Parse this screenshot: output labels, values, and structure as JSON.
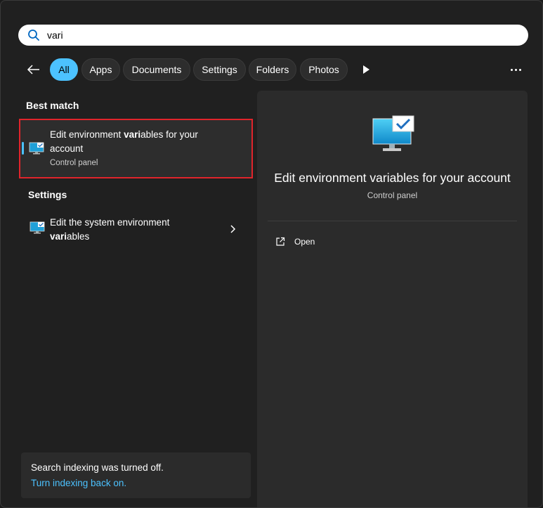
{
  "search": {
    "value": "vari",
    "icon": "search-icon"
  },
  "filters": {
    "back_icon": "arrow-left-icon",
    "chips": [
      "All",
      "Apps",
      "Documents",
      "Settings",
      "Folders",
      "Photos"
    ],
    "active": "All",
    "more_icon": "play-icon",
    "overflow_icon": "more-dots-icon"
  },
  "best_match": {
    "heading": "Best match",
    "title_pre": "Edit environment ",
    "title_bold": "vari",
    "title_post": "ables for your",
    "title_line2": "account",
    "subtitle": "Control panel",
    "icon": "control-panel-monitor-icon"
  },
  "settings": {
    "heading": "Settings",
    "item": {
      "line1": "Edit the system environment",
      "line2_bold": "vari",
      "line2_rest": "ables",
      "icon": "control-panel-monitor-icon",
      "chevron_icon": "chevron-right-icon"
    }
  },
  "index_notice": {
    "message": "Search indexing was turned off.",
    "link": "Turn indexing back on."
  },
  "details": {
    "title": "Edit environment variables for your account",
    "subtitle": "Control panel",
    "actions": [
      {
        "label": "Open",
        "icon": "open-external-icon"
      }
    ]
  },
  "colors": {
    "accent": "#4cc2ff",
    "highlight_border": "#e0242b",
    "background": "#202020",
    "panel": "#2b2b2b"
  }
}
